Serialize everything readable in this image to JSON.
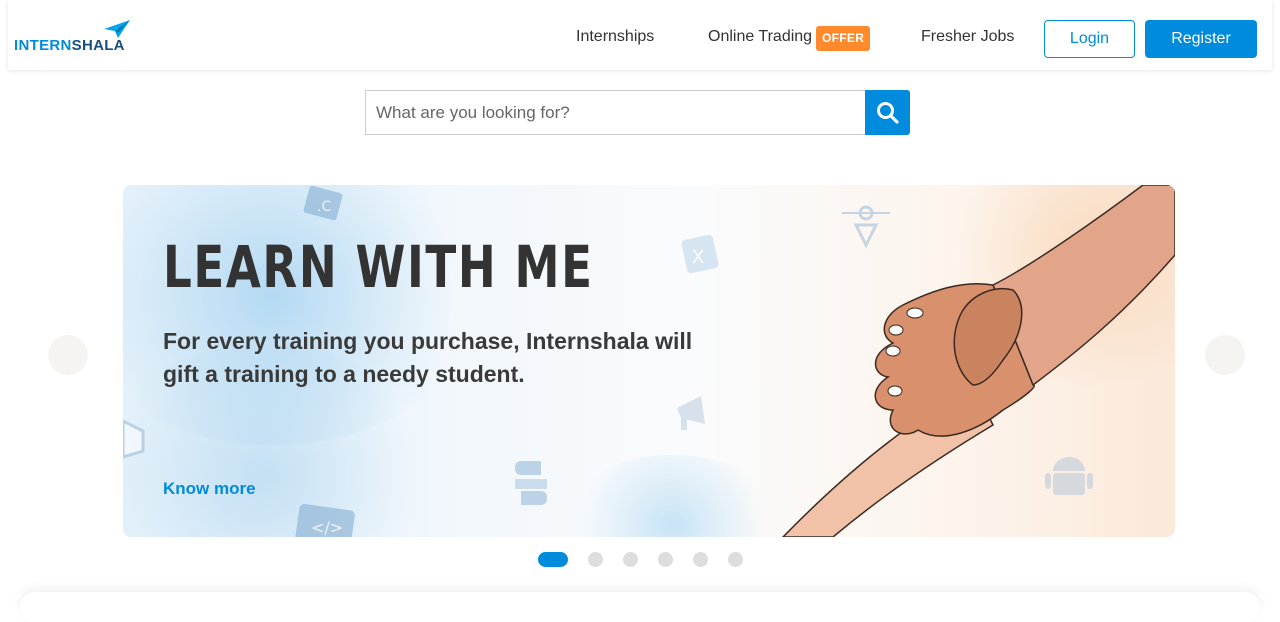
{
  "header": {
    "logo": {
      "part1": "INTERN",
      "part2": "SHALA",
      "icon": "paper-plane-icon"
    },
    "nav": {
      "internships": "Internships",
      "trading": "Online Trading",
      "trading_badge": "OFFER",
      "fresher_jobs": "Fresher Jobs"
    },
    "login_label": "Login",
    "register_label": "Register"
  },
  "search": {
    "placeholder": "What are you looking for?",
    "value": "",
    "icon": "search-icon"
  },
  "banner": {
    "title": "LEARN WITH ME",
    "subtitle": "For every training you purchase, Internshala will gift a training to a needy student.",
    "link_label": "Know more"
  },
  "carousel": {
    "slide_count": 6,
    "active_index": 0,
    "prev_icon": "chevron-left-icon",
    "next_icon": "chevron-right-icon"
  },
  "colors": {
    "brand": "#008bdc",
    "offer": "#ff8a2b"
  }
}
